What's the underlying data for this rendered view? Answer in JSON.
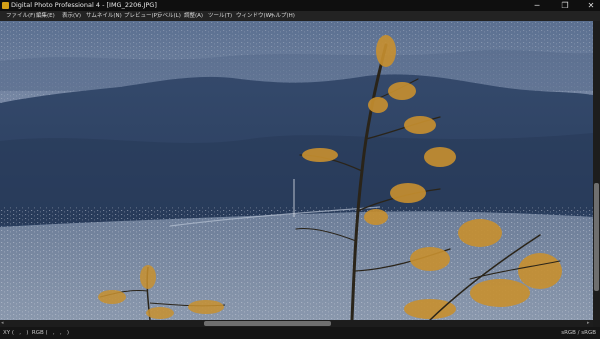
{
  "window": {
    "title": "Digital Photo Professional 4 - [IMG_2206.JPG]",
    "minimize_glyph": "─",
    "restore_glyph": "❐",
    "close_glyph": "✕"
  },
  "menu": {
    "items": [
      {
        "label": "ファイル(F)"
      },
      {
        "label": "編集(E)"
      },
      {
        "label": "表示(V)"
      },
      {
        "label": "サムネイル(N)"
      },
      {
        "label": "プレビュー(P)"
      },
      {
        "label": "ラベル(L)"
      },
      {
        "label": "調整(A)"
      },
      {
        "label": "ツール(T)"
      },
      {
        "label": "ウィンドウ(W)"
      },
      {
        "label": "ヘルプ(H)"
      }
    ]
  },
  "image": {
    "subject": "autumn larch branches in front of mountains and a town valley",
    "colors": {
      "sky": "#4a5f80",
      "mountain": "#2f4466",
      "town": "#8a98ad",
      "branch": "#c8902f"
    }
  },
  "scrollbars": {
    "left_arrow": "◂",
    "right_arrow": "▸"
  },
  "status": {
    "coords": "XY (   ,   )  RGB (   ,   ,   )",
    "color_space": "sRGB / sRGB"
  }
}
